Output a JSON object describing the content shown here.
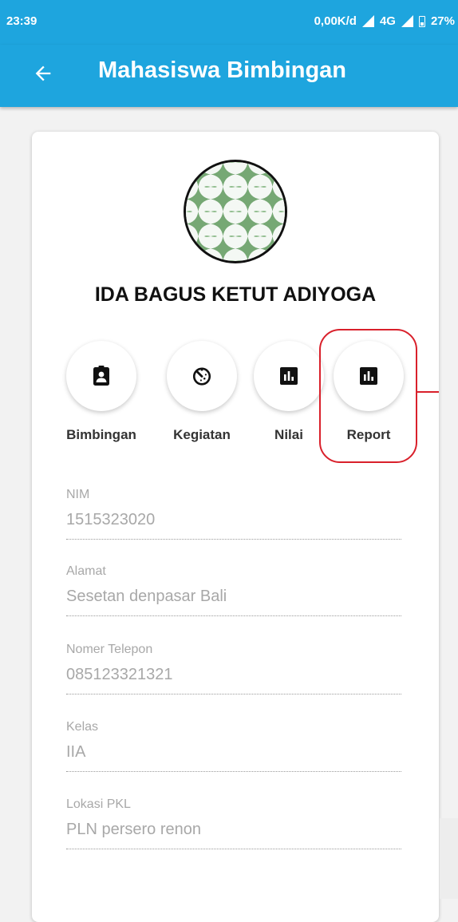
{
  "status_bar": {
    "time": "23:39",
    "network_speed": "0,00K/d",
    "network_type": "4G",
    "battery": "27%"
  },
  "app_bar": {
    "title": "Mahasiswa Bimbingan",
    "back_icon": "arrow-left-icon",
    "background_color": "#1ea5de"
  },
  "student": {
    "name": "IDA BAGUS KETUT ADIYOGA",
    "avatar_icon": "geometric-pattern-avatar"
  },
  "actions": [
    {
      "label": "Bimbingan",
      "icon": "contact-badge-icon"
    },
    {
      "label": "Kegiatan",
      "icon": "timer-icon"
    },
    {
      "label": "Nilai",
      "icon": "bar-chart-icon"
    },
    {
      "label": "Report",
      "icon": "bar-chart-icon"
    }
  ],
  "highlight_color": "#d9202b",
  "fields": [
    {
      "label": "NIM",
      "value": "1515323020"
    },
    {
      "label": "Alamat",
      "value": "Sesetan denpasar Bali"
    },
    {
      "label": "Nomer Telepon",
      "value": "085123321321"
    },
    {
      "label": "Kelas",
      "value": "IIA"
    },
    {
      "label": "Lokasi PKL",
      "value": "PLN persero renon"
    }
  ]
}
